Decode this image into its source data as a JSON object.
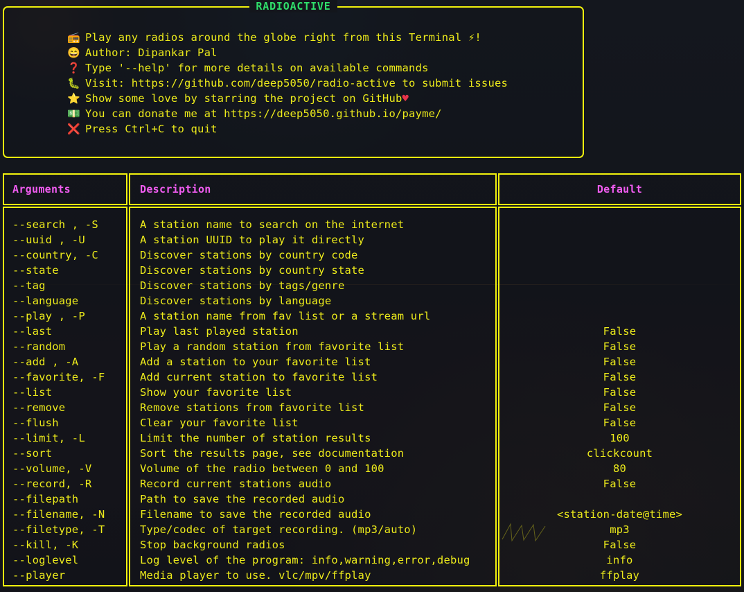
{
  "panel": {
    "title": "RADIOACTIVE",
    "title_color": "#2fe06b",
    "border_color": "#f1f10d",
    "lines": [
      {
        "icon": "radio-icon",
        "glyph": "📻",
        "text": "Play any radios around the globe right from this Terminal ⚡!"
      },
      {
        "icon": "grinning-face-icon",
        "glyph": "😄",
        "text": "Author: Dipankar Pal"
      },
      {
        "icon": "question-mark-icon",
        "glyph": "❓",
        "text": "Type '--help' for more details on available commands"
      },
      {
        "icon": "caterpillar-icon",
        "glyph": "🐛",
        "text": "Visit: https://github.com/deep5050/radio-active to submit issues"
      },
      {
        "icon": "star-icon",
        "glyph": "⭐",
        "text": "Show some love by starring the project on GitHub ",
        "suffix_heart": "♥"
      },
      {
        "icon": "banknote-icon",
        "glyph": "💵",
        "text": "You can donate me at https://deep5050.github.io/payme/"
      },
      {
        "icon": "cross-mark-icon",
        "glyph": "❌",
        "text": "Press Ctrl+C to quit"
      }
    ]
  },
  "table": {
    "header_color": "#f05cf0",
    "text_color": "#edeb1b",
    "headers": {
      "arguments": "Arguments",
      "description": "Description",
      "default": "Default"
    },
    "rows": [
      {
        "argument": "--search , -S",
        "description": "A station name to search on the internet",
        "default": ""
      },
      {
        "argument": "--uuid , -U",
        "description": "A station UUID to play it directly",
        "default": ""
      },
      {
        "argument": "--country, -C",
        "description": "Discover stations by country code",
        "default": ""
      },
      {
        "argument": "--state",
        "description": "Discover stations by country state",
        "default": ""
      },
      {
        "argument": "--tag",
        "description": "Discover stations by tags/genre",
        "default": ""
      },
      {
        "argument": "--language",
        "description": "Discover stations by language",
        "default": ""
      },
      {
        "argument": "--play , -P",
        "description": "A station name from fav list or a stream url",
        "default": ""
      },
      {
        "argument": "--last",
        "description": "Play last played station",
        "default": "False"
      },
      {
        "argument": "--random",
        "description": "Play a random station from favorite list",
        "default": "False"
      },
      {
        "argument": "--add , -A",
        "description": "Add a station to your favorite list",
        "default": "False"
      },
      {
        "argument": "--favorite, -F",
        "description": "Add current station to favorite list",
        "default": "False"
      },
      {
        "argument": "--list",
        "description": "Show your favorite list",
        "default": "False"
      },
      {
        "argument": "--remove",
        "description": "Remove stations from favorite list",
        "default": "False"
      },
      {
        "argument": "--flush",
        "description": "Clear your favorite list",
        "default": "False"
      },
      {
        "argument": "--limit, -L",
        "description": "Limit the number of station results",
        "default": "100"
      },
      {
        "argument": "--sort",
        "description": "Sort the results page, see documentation",
        "default": "clickcount"
      },
      {
        "argument": "--volume, -V",
        "description": "Volume of the radio between 0 and 100",
        "default": "80"
      },
      {
        "argument": "--record, -R",
        "description": "Record current stations audio",
        "default": "False"
      },
      {
        "argument": "--filepath",
        "description": "Path to save the recorded audio",
        "default": ""
      },
      {
        "argument": "--filename, -N",
        "description": "Filename to save the recorded audio",
        "default": "<station-date@time>"
      },
      {
        "argument": "--filetype, -T",
        "description": "Type/codec of target recording. (mp3/auto)",
        "default": "mp3"
      },
      {
        "argument": "--kill, -K",
        "description": "Stop background radios",
        "default": "False"
      },
      {
        "argument": "--loglevel",
        "description": "Log level of the program: info,warning,error,debug",
        "default": "info"
      },
      {
        "argument": "--player",
        "description": "Media player to use. vlc/mpv/ffplay",
        "default": "ffplay"
      }
    ]
  }
}
